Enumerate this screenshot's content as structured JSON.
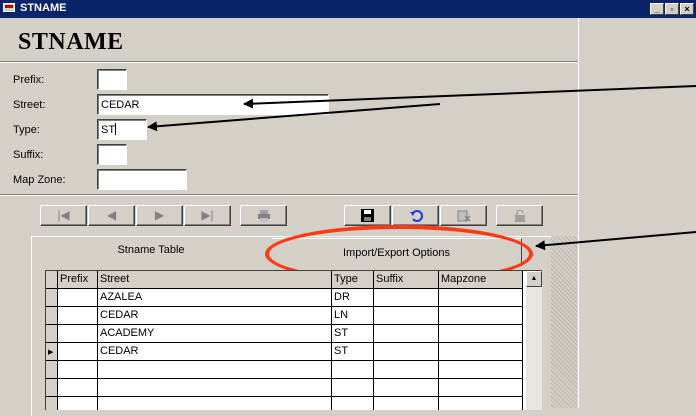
{
  "window": {
    "title": "STNAME",
    "controls": [
      "_",
      "▫",
      "×"
    ]
  },
  "heading": "STNAME",
  "form": {
    "prefix": {
      "label": "Prefix:",
      "value": ""
    },
    "street": {
      "label": "Street:",
      "value": "CEDAR"
    },
    "type": {
      "label": "Type:",
      "value": "ST"
    },
    "suffix": {
      "label": "Suffix:",
      "value": ""
    },
    "mapzone": {
      "label": "Map Zone:",
      "value": ""
    }
  },
  "toolbar": {
    "nav": [
      "first-record-icon",
      "previous-record-icon",
      "next-record-icon",
      "last-record-icon",
      "print-icon"
    ],
    "edit": [
      "save-icon",
      "undo-icon",
      "delete-icon",
      "lock-icon"
    ]
  },
  "tabs": [
    {
      "label": "Stname Table",
      "active": true
    },
    {
      "label": "Import/Export Options",
      "active": false
    }
  ],
  "grid": {
    "columns": [
      "Prefix",
      "Street",
      "Type",
      "Suffix",
      "Mapzone"
    ],
    "rows": [
      [
        "",
        "AZALEA",
        "DR",
        "",
        ""
      ],
      [
        "",
        "CEDAR",
        "LN",
        "",
        ""
      ],
      [
        "",
        "ACADEMY",
        "ST",
        "",
        ""
      ],
      [
        "",
        "CEDAR",
        "ST",
        "",
        ""
      ],
      [
        "",
        "",
        "",
        "",
        ""
      ],
      [
        "",
        "",
        "",
        "",
        ""
      ],
      [
        "",
        "",
        "",
        "",
        ""
      ]
    ],
    "current_row_index": 3
  },
  "colors": {
    "titlebar": "#0a246a",
    "annotation": "#ff3b17",
    "face": "#d4d0c8"
  }
}
